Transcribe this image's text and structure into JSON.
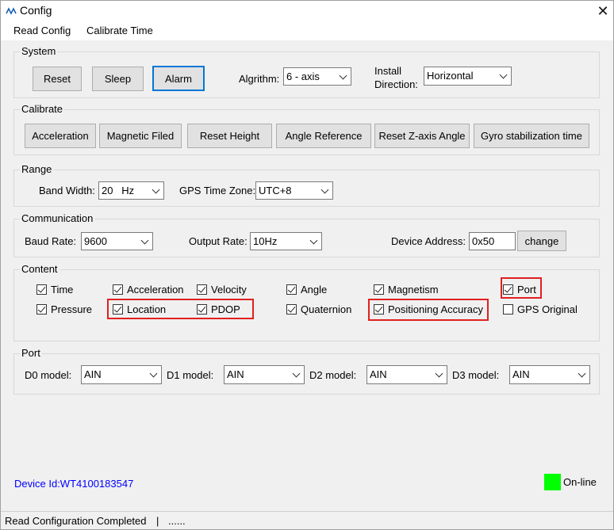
{
  "window": {
    "title": "Config",
    "close_symbol": "✕"
  },
  "menu": {
    "items": [
      "Read Config",
      "Calibrate Time"
    ]
  },
  "system": {
    "title": "System",
    "buttons": [
      "Reset",
      "Sleep",
      "Alarm"
    ],
    "algorithm_label": "Algrithm:",
    "algorithm_value": "6 - axis",
    "install_label_1": "Install",
    "install_label_2": "Direction:",
    "install_value": "Horizontal"
  },
  "calibrate": {
    "title": "Calibrate",
    "buttons": [
      "Acceleration",
      "Magnetic Filed",
      "Reset Height",
      "Angle Reference",
      "Reset Z-axis Angle",
      "Gyro stabilization time"
    ]
  },
  "range": {
    "title": "Range",
    "bandwidth_label": "Band Width:",
    "bandwidth_value": "20   Hz",
    "timezone_label": "GPS Time Zone:",
    "timezone_value": "UTC+8"
  },
  "communication": {
    "title": "Communication",
    "baud_label": "Baud Rate:",
    "baud_value": "9600",
    "output_label": "Output Rate:",
    "output_value": "10Hz",
    "address_label": "Device Address:",
    "address_value": "0x50",
    "change_label": "change"
  },
  "content": {
    "title": "Content",
    "items": [
      {
        "label": "Time",
        "checked": true
      },
      {
        "label": "Acceleration",
        "checked": true
      },
      {
        "label": "Velocity",
        "checked": true
      },
      {
        "label": "Angle",
        "checked": true
      },
      {
        "label": "Magnetism",
        "checked": true
      },
      {
        "label": "Port",
        "checked": true
      },
      {
        "label": "Pressure",
        "checked": true
      },
      {
        "label": "Location",
        "checked": true
      },
      {
        "label": "PDOP",
        "checked": true
      },
      {
        "label": "Quaternion",
        "checked": true
      },
      {
        "label": "Positioning Accuracy",
        "checked": true
      },
      {
        "label": "GPS Original",
        "checked": false
      }
    ]
  },
  "port": {
    "title": "Port",
    "models": [
      {
        "label": "D0 model:",
        "value": "AIN"
      },
      {
        "label": "D1 model:",
        "value": "AIN"
      },
      {
        "label": "D2 model:",
        "value": "AIN"
      },
      {
        "label": "D3 model:",
        "value": "AIN"
      }
    ]
  },
  "footer": {
    "device_id": "Device Id:WT4100183547",
    "online_label": "On-line",
    "online_color": "#00ff00",
    "device_id_color": "#0000ff"
  },
  "status": {
    "message": "Read Configuration Completed",
    "separator": "|",
    "extra": "......"
  },
  "colors": {
    "highlight": "#e02020",
    "focus": "#0078d7"
  }
}
